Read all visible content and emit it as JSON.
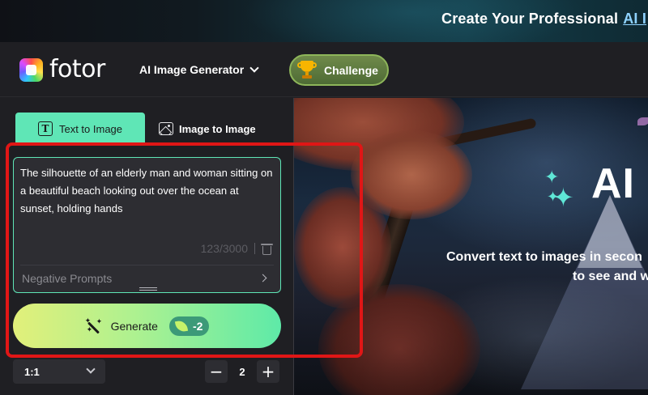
{
  "banner": {
    "text": "Create Your Professional",
    "highlight": "AI I"
  },
  "header": {
    "logo_text": "fotor",
    "menu_label": "AI Image Generator",
    "challenge_label": "Challenge"
  },
  "tabs": [
    {
      "label": "Text to Image",
      "active": true
    },
    {
      "label": "Image to Image",
      "active": false
    }
  ],
  "prompt": {
    "text": "The silhouette of an elderly man and woman sitting on a beautiful beach looking out over the ocean at sunset, holding hands",
    "counter": "123/3000",
    "negative_label": "Negative Prompts"
  },
  "generate": {
    "label": "Generate",
    "cost": "-2"
  },
  "options": {
    "ratio": "1:1",
    "count": "2",
    "minus": "−",
    "plus": "+"
  },
  "hero": {
    "title": "AI",
    "subtitle_line1": "Convert text to images in secon",
    "subtitle_line2": "to see and w"
  },
  "colors": {
    "accent": "#5fe6b6",
    "annotation": "#e01616"
  }
}
